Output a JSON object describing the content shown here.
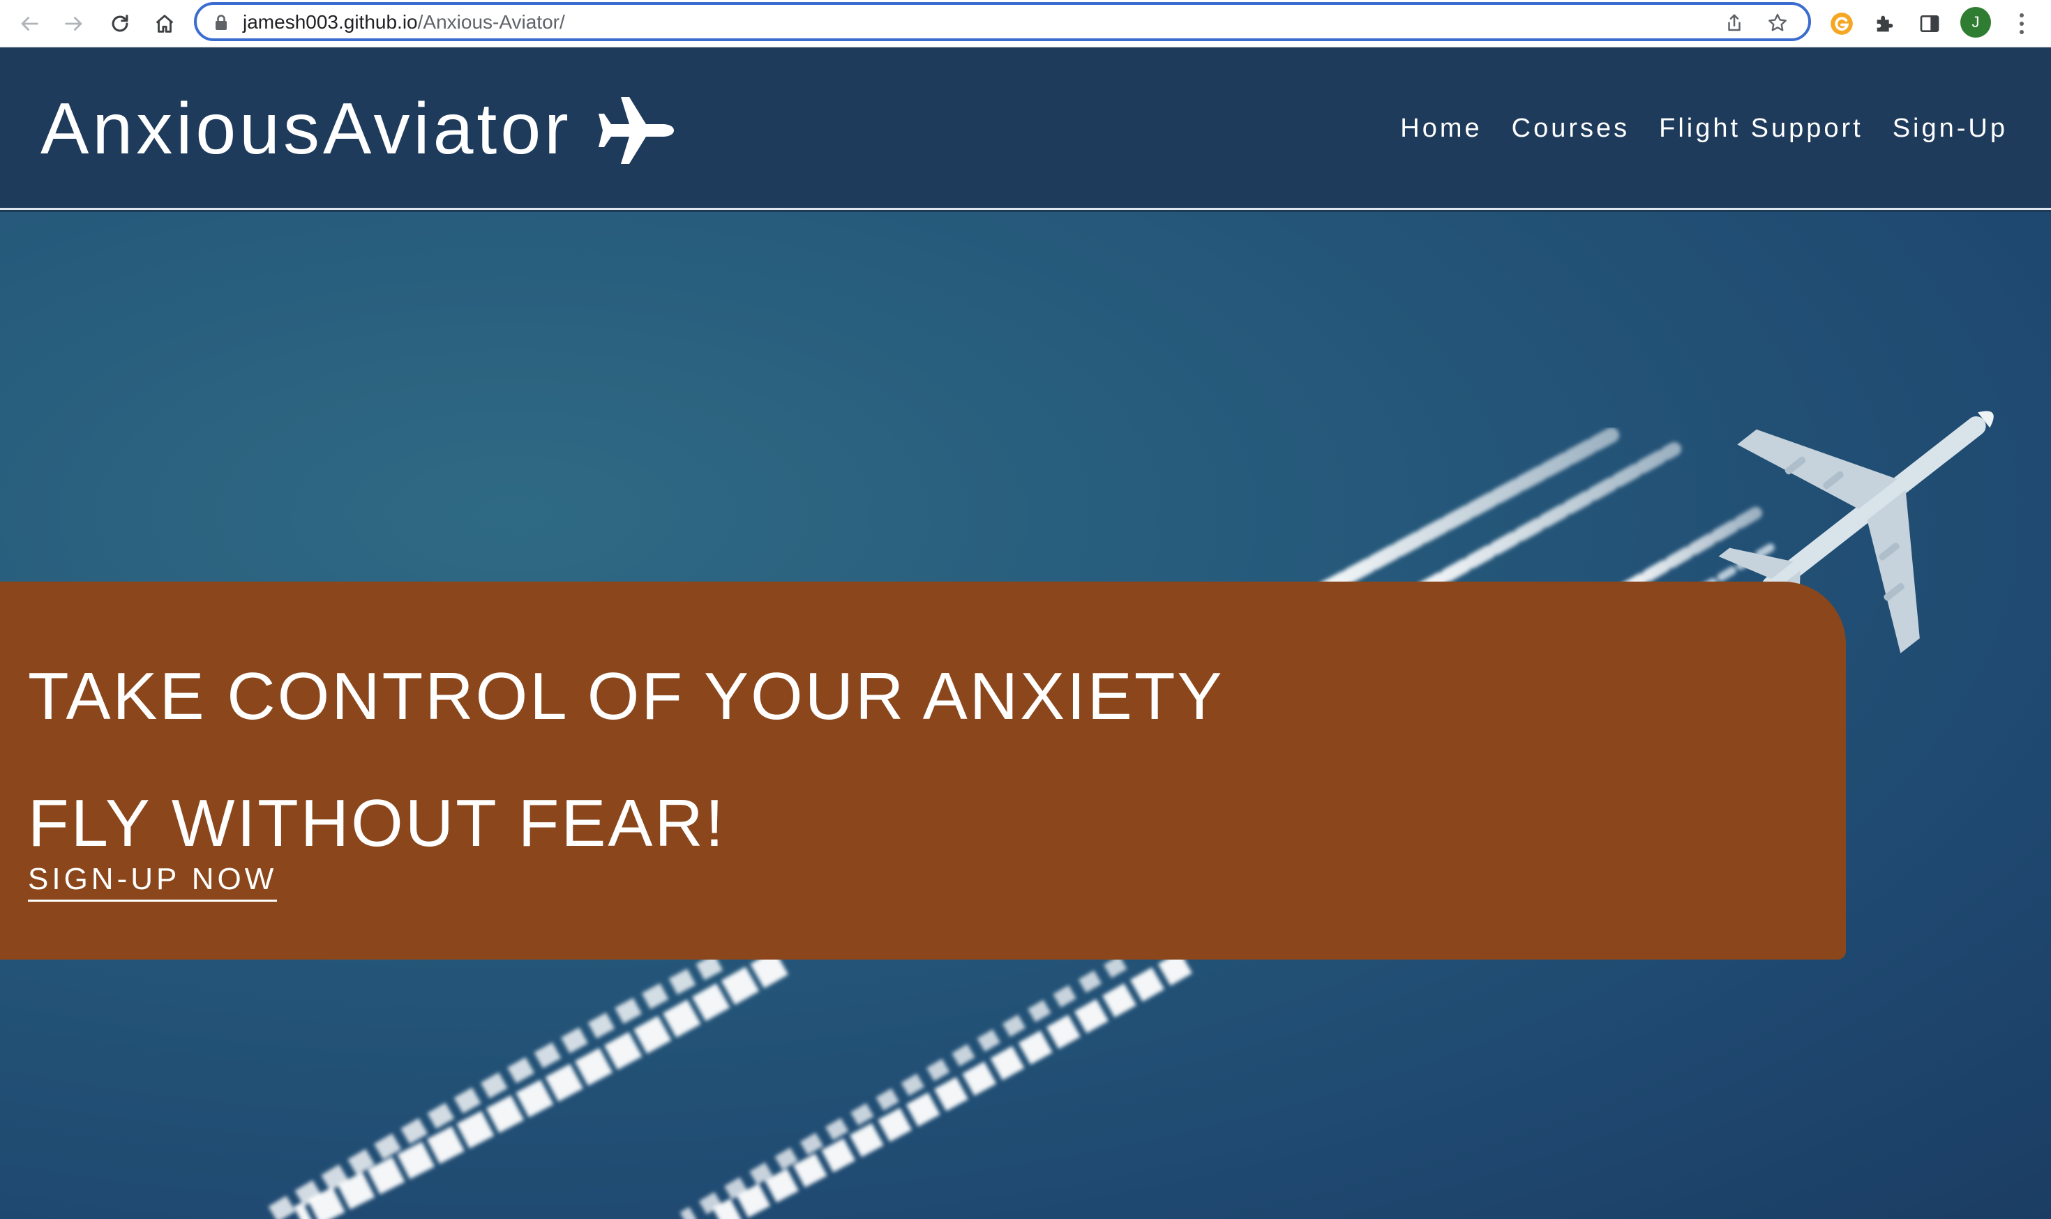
{
  "browser": {
    "url_domain": "jamesh003.github.io",
    "url_path": "/Anxious-Aviator/",
    "profile_initial": "J",
    "icons": [
      "back-icon",
      "forward-icon",
      "reload-icon",
      "home-icon",
      "lock-icon",
      "share-icon",
      "bookmark-star-icon",
      "grammarly-extension-icon",
      "extensions-puzzle-icon",
      "side-panel-icon",
      "more-menu-icon"
    ]
  },
  "site": {
    "brand": "AnxiousAviator",
    "brand_icon": "plane-icon",
    "nav": [
      "Home",
      "Courses",
      "Flight Support",
      "Sign-Up"
    ]
  },
  "hero": {
    "headline_1": "TAKE CONTROL OF YOUR ANXIETY",
    "headline_2": "FLY WITHOUT FEAR!",
    "cta_label": "SIGN-UP NOW",
    "background": "aircraft-contrails-photo"
  },
  "colors": {
    "header_bg": "#1f3b5b",
    "cta_panel": "#8b471b",
    "sky": "#25587a",
    "omnibox_focus": "#3b6ccf"
  }
}
